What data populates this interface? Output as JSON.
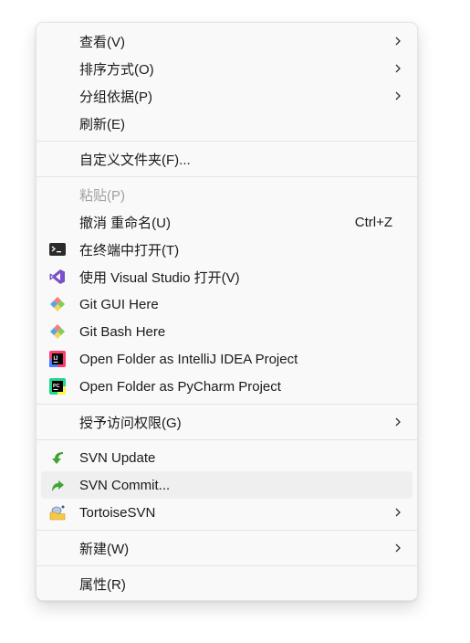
{
  "menu": {
    "view": "查看(V)",
    "sort": "排序方式(O)",
    "group": "分组依据(P)",
    "refresh": "刷新(E)",
    "customize": "自定义文件夹(F)...",
    "paste": "粘贴(P)",
    "undo": "撤消 重命名(U)",
    "undo_shortcut": "Ctrl+Z",
    "terminal": "在终端中打开(T)",
    "vs": "使用 Visual Studio 打开(V)",
    "git_gui": "Git GUI Here",
    "git_bash": "Git Bash Here",
    "intellij": "Open Folder as IntelliJ IDEA Project",
    "pycharm": "Open Folder as PyCharm Project",
    "grant": "授予访问权限(G)",
    "svn_update": "SVN Update",
    "svn_commit": "SVN Commit...",
    "tortoise": "TortoiseSVN",
    "new": "新建(W)",
    "properties": "属性(R)"
  }
}
